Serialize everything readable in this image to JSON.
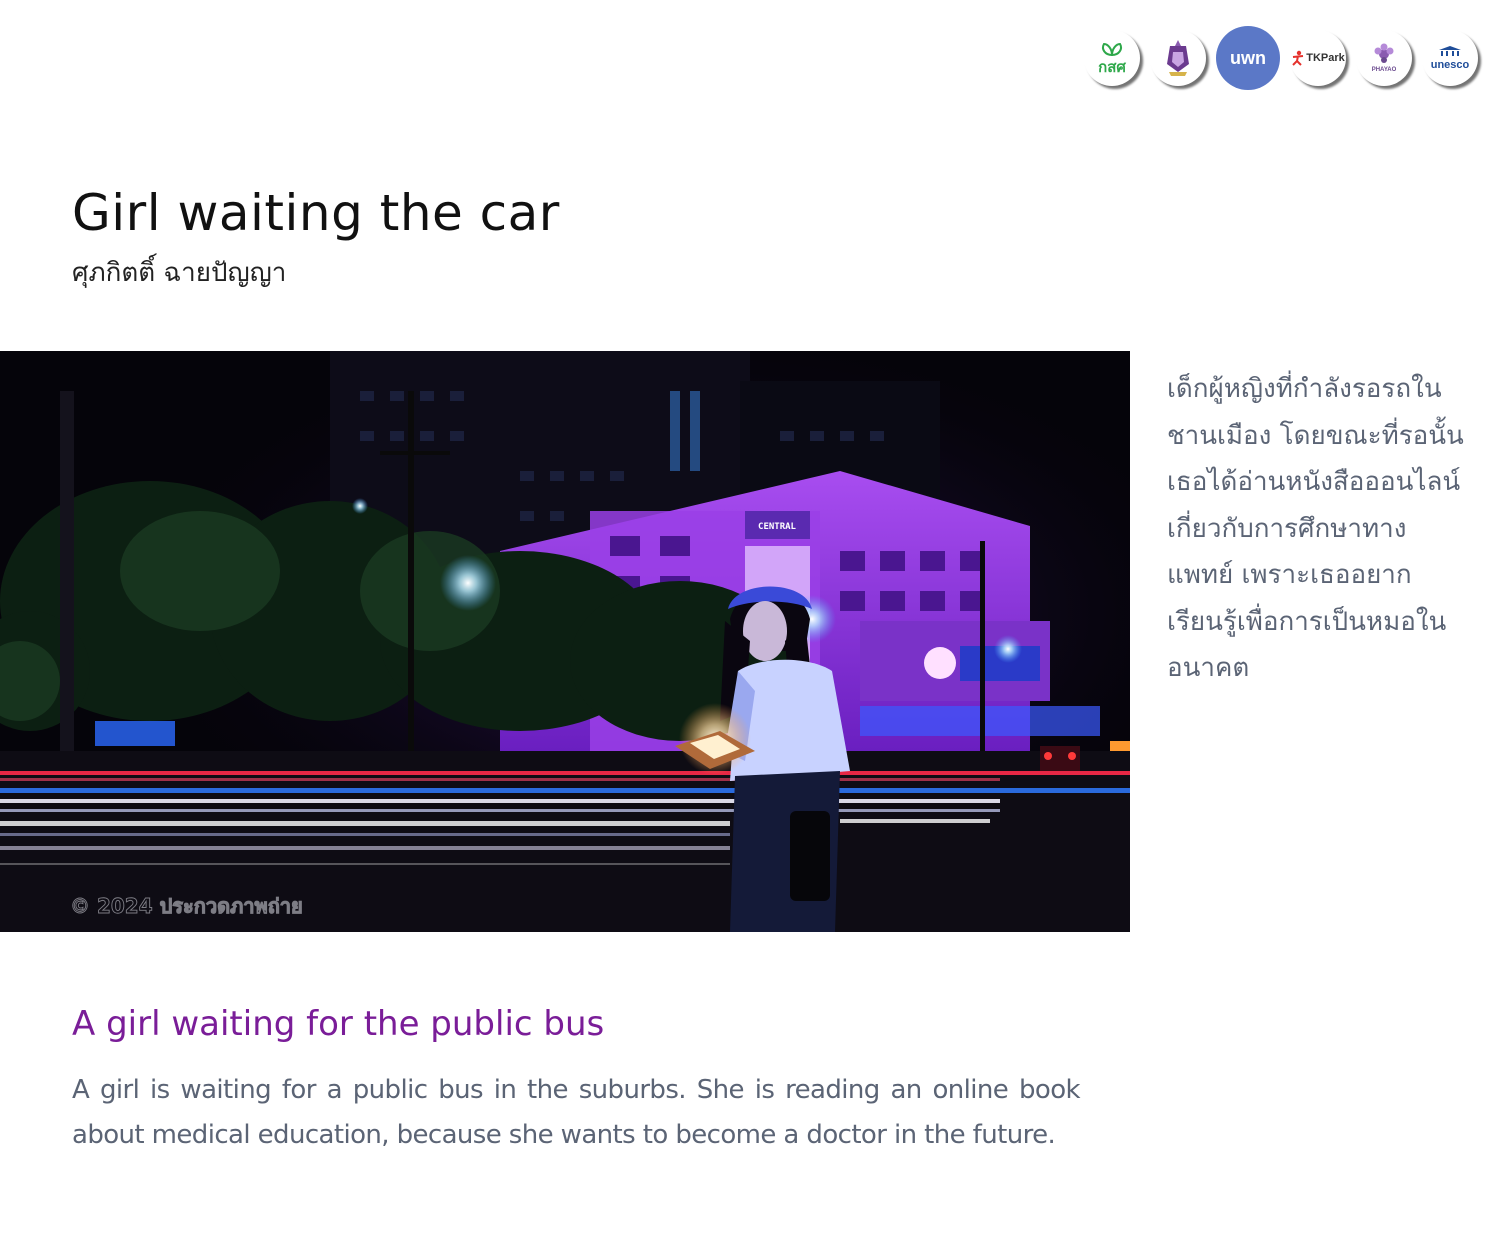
{
  "logos": [
    {
      "name": "kss-logo",
      "text": "กสศ",
      "color": "#2ea84a"
    },
    {
      "name": "university-logo",
      "text": "",
      "color": "#6b3a8f"
    },
    {
      "name": "uwn-logo",
      "text": "uwn",
      "color": "#5b78c7"
    },
    {
      "name": "tkpark-logo",
      "text": "TKPark",
      "color": "#e5322d"
    },
    {
      "name": "phayao-logo",
      "text": "PHAYAO",
      "color": "#6b4a8f"
    },
    {
      "name": "unesco-logo",
      "text": "unesco",
      "color": "#1f4d99"
    }
  ],
  "entry": {
    "title": "Girl waiting the car",
    "author": "ศุภกิตติ์ ฉายปัญญา",
    "thai_caption": "เด็กผู้หญิงที่กำลังรอรถในชานเมือง โดยขณะที่รอนั้นเธอได้อ่านหนังสือออนไลน์เกี่ยวกับการศึกษาทางแพทย์ เพราะเธออยากเรียนรู้เพื่อการเป็นหมอในอนาคต",
    "en_title": "A girl waiting for the public bus",
    "en_body": "A girl is waiting for a public bus in the suburbs. She is reading an online book about medical education, because she wants to become a doctor in the future."
  },
  "photo": {
    "watermark": "© 2024 ประกวดภาพถ่าย",
    "sign": "CENTRAL",
    "colors": {
      "sky": "#05040a",
      "building_neon": "#8b2fd8",
      "light_trail_red": "#ff2a4a",
      "light_trail_white": "#f2f0ff",
      "light_trail_blue": "#2f7bff"
    }
  }
}
